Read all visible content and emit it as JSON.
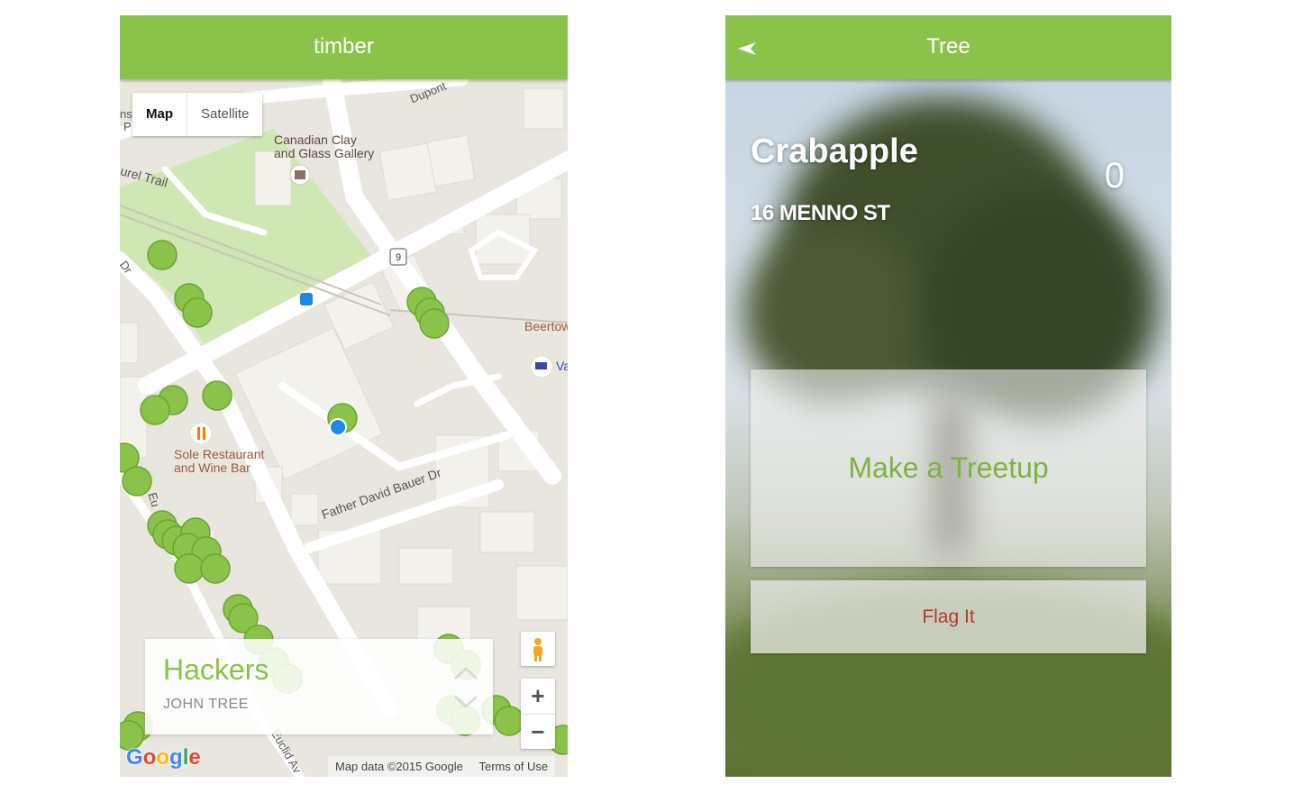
{
  "left_screen": {
    "app_title": "timber",
    "map_type": {
      "map_label": "Map",
      "satellite_label": "Satellite",
      "selected": "Map"
    },
    "map_labels": {
      "dupont": "Dupont",
      "gallery_line1": "Canadian Clay",
      "gallery_line2": "and Glass Gallery",
      "laurel_trail": "urel Trail",
      "route_number": "9",
      "beertown": "Beertow",
      "va": "Va",
      "restaurant_line1": "Sole Restaurant",
      "restaurant_line2": "and Wine Bar",
      "street_father": "Father David Bauer Dr",
      "street_euclid": "Euclid Av",
      "dr": "Dr",
      "edge_ns": "ns",
      "edge_p": "P",
      "street_eu": "Eu"
    },
    "info_card": {
      "title": "Hackers",
      "subtitle": "JOHN TREE"
    },
    "controls": {
      "zoom_in": "+",
      "zoom_out": "−"
    },
    "google_logo": "Google",
    "attribution": {
      "map_data": "Map data ©2015 Google",
      "terms": "Terms of Use"
    },
    "colors": {
      "tree_marker": "#8bc34a",
      "user_location": "#1e88e5"
    }
  },
  "right_screen": {
    "app_title": "Tree",
    "tree_name": "Crabapple",
    "treetup_count": "0",
    "address": "16 MENNO ST",
    "make_treetup_label": "Make a Treetup",
    "flag_label": "Flag It"
  },
  "colors": {
    "appbar": "#8bc34a",
    "flag_text": "#b03a2e",
    "treetup_text": "#7cb342"
  }
}
